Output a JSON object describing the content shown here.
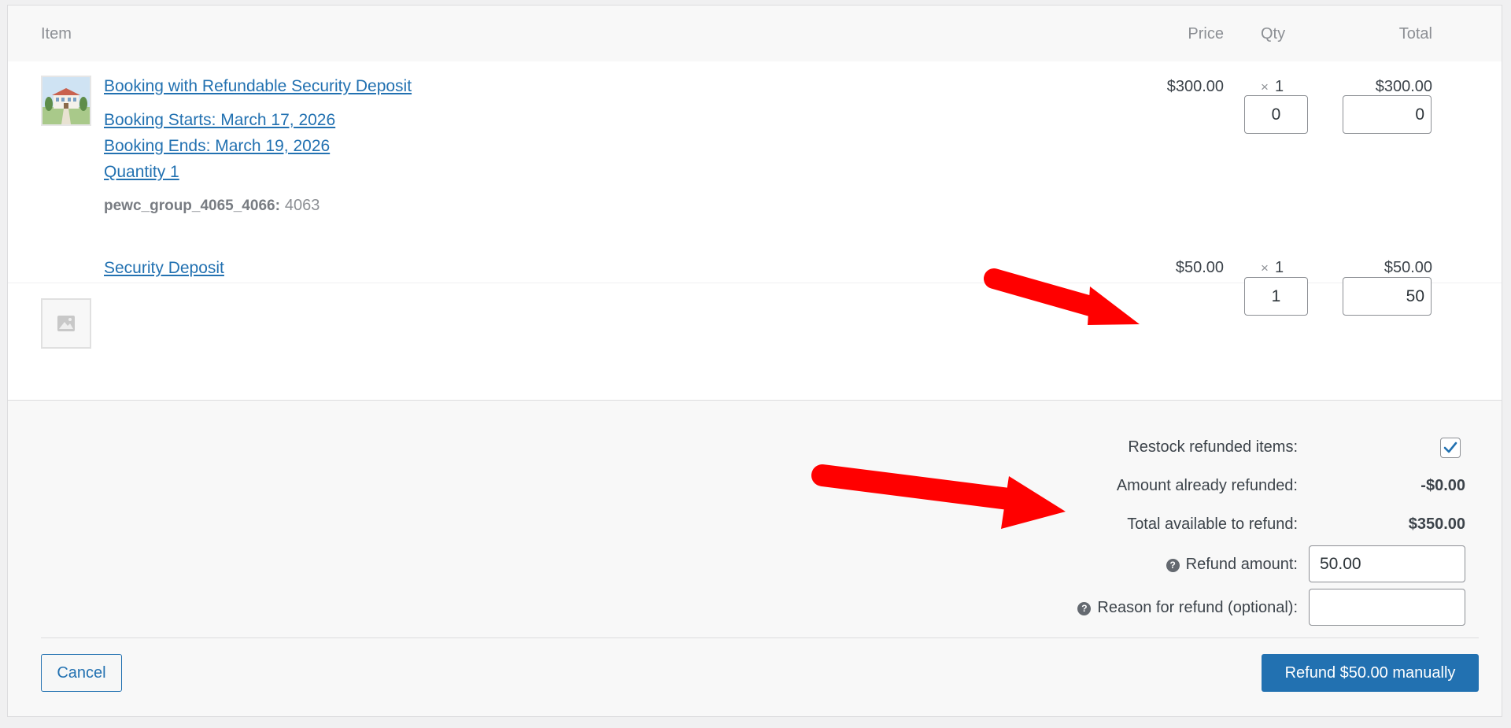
{
  "table": {
    "headers": {
      "item": "Item",
      "price": "Price",
      "qty": "Qty",
      "total": "Total"
    },
    "rows": [
      {
        "name": "Booking with Refundable Security Deposit",
        "meta_links": [
          "Booking Starts: March 17, 2026",
          "Booking Ends: March 19, 2026",
          "Quantity 1"
        ],
        "meta_key": "pewc_group_4065_4066:",
        "meta_value": "4063",
        "price": "$300.00",
        "qty_x": "×",
        "qty": "1",
        "total": "$300.00",
        "refund_qty": "0",
        "refund_total": "0",
        "thumbnail": "villa-image"
      },
      {
        "name": "Security Deposit",
        "price": "$50.00",
        "qty_x": "×",
        "qty": "1",
        "total": "$50.00",
        "refund_qty": "1",
        "refund_total": "50",
        "thumbnail": "placeholder-image-icon"
      }
    ]
  },
  "refund": {
    "restock_label": "Restock refunded items:",
    "restock_checked": true,
    "already_refunded_label": "Amount already refunded:",
    "already_refunded_value": "-$0.00",
    "available_label": "Total available to refund:",
    "available_value": "$350.00",
    "amount_label": "Refund amount:",
    "amount_value": "50.00",
    "reason_label": "Reason for refund (optional):",
    "reason_value": "",
    "help_glyph": "?"
  },
  "buttons": {
    "cancel": "Cancel",
    "refund": "Refund $50.00 manually"
  },
  "colors": {
    "accent": "#2271b1",
    "annotation_arrow": "#ff0000"
  }
}
